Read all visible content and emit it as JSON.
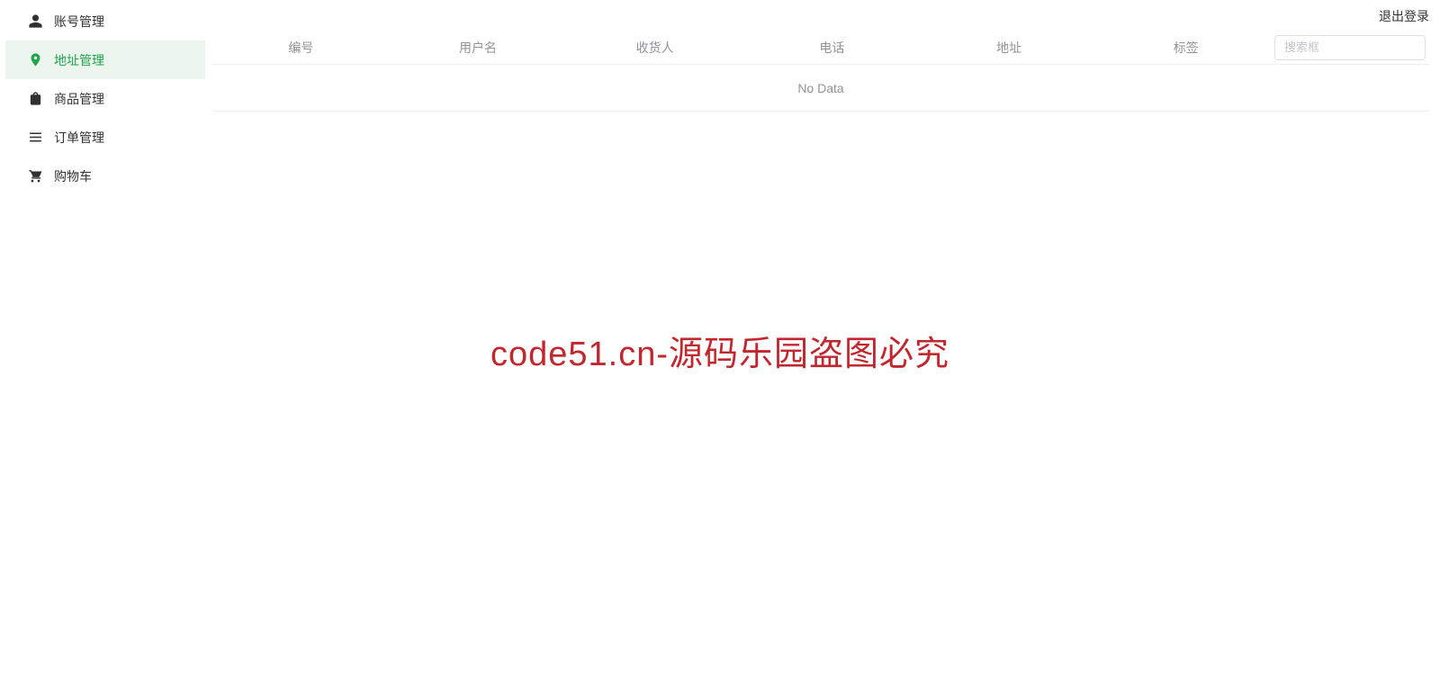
{
  "header": {
    "logout_label": "退出登录"
  },
  "sidebar": {
    "items": [
      {
        "label": "账号管理",
        "icon": "user-icon",
        "active": false
      },
      {
        "label": "地址管理",
        "icon": "location-icon",
        "active": true
      },
      {
        "label": "商品管理",
        "icon": "bag-icon",
        "active": false
      },
      {
        "label": "订单管理",
        "icon": "list-icon",
        "active": false
      },
      {
        "label": "购物车",
        "icon": "cart-icon",
        "active": false
      }
    ]
  },
  "table": {
    "columns": [
      {
        "label": "编号"
      },
      {
        "label": "用户名"
      },
      {
        "label": "收货人"
      },
      {
        "label": "电话"
      },
      {
        "label": "地址"
      },
      {
        "label": "标签"
      }
    ],
    "search_placeholder": "搜索框",
    "empty_text": "No Data",
    "rows": []
  },
  "watermark": {
    "text": "code51.cn-源码乐园盗图必究"
  }
}
